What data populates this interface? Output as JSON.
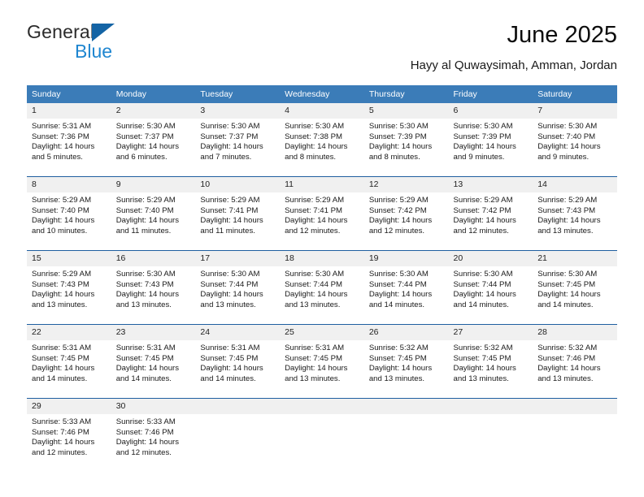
{
  "brand": {
    "line1": "General",
    "line2": "Blue",
    "triangle_color": "#1464a5",
    "blue_text_color": "#1f86d0"
  },
  "header": {
    "title": "June 2025",
    "subtitle": "Hayy al Quwaysimah, Amman, Jordan",
    "header_bg_color": "#3b7cb8",
    "row_divider_color": "#1f5fa0",
    "daynum_bg_color": "#f0f0f0"
  },
  "weekdays": [
    "Sunday",
    "Monday",
    "Tuesday",
    "Wednesday",
    "Thursday",
    "Friday",
    "Saturday"
  ],
  "weeks": [
    [
      {
        "day": "1",
        "sunrise": "Sunrise: 5:31 AM",
        "sunset": "Sunset: 7:36 PM",
        "daylight1": "Daylight: 14 hours",
        "daylight2": "and 5 minutes."
      },
      {
        "day": "2",
        "sunrise": "Sunrise: 5:30 AM",
        "sunset": "Sunset: 7:37 PM",
        "daylight1": "Daylight: 14 hours",
        "daylight2": "and 6 minutes."
      },
      {
        "day": "3",
        "sunrise": "Sunrise: 5:30 AM",
        "sunset": "Sunset: 7:37 PM",
        "daylight1": "Daylight: 14 hours",
        "daylight2": "and 7 minutes."
      },
      {
        "day": "4",
        "sunrise": "Sunrise: 5:30 AM",
        "sunset": "Sunset: 7:38 PM",
        "daylight1": "Daylight: 14 hours",
        "daylight2": "and 8 minutes."
      },
      {
        "day": "5",
        "sunrise": "Sunrise: 5:30 AM",
        "sunset": "Sunset: 7:39 PM",
        "daylight1": "Daylight: 14 hours",
        "daylight2": "and 8 minutes."
      },
      {
        "day": "6",
        "sunrise": "Sunrise: 5:30 AM",
        "sunset": "Sunset: 7:39 PM",
        "daylight1": "Daylight: 14 hours",
        "daylight2": "and 9 minutes."
      },
      {
        "day": "7",
        "sunrise": "Sunrise: 5:30 AM",
        "sunset": "Sunset: 7:40 PM",
        "daylight1": "Daylight: 14 hours",
        "daylight2": "and 9 minutes."
      }
    ],
    [
      {
        "day": "8",
        "sunrise": "Sunrise: 5:29 AM",
        "sunset": "Sunset: 7:40 PM",
        "daylight1": "Daylight: 14 hours",
        "daylight2": "and 10 minutes."
      },
      {
        "day": "9",
        "sunrise": "Sunrise: 5:29 AM",
        "sunset": "Sunset: 7:40 PM",
        "daylight1": "Daylight: 14 hours",
        "daylight2": "and 11 minutes."
      },
      {
        "day": "10",
        "sunrise": "Sunrise: 5:29 AM",
        "sunset": "Sunset: 7:41 PM",
        "daylight1": "Daylight: 14 hours",
        "daylight2": "and 11 minutes."
      },
      {
        "day": "11",
        "sunrise": "Sunrise: 5:29 AM",
        "sunset": "Sunset: 7:41 PM",
        "daylight1": "Daylight: 14 hours",
        "daylight2": "and 12 minutes."
      },
      {
        "day": "12",
        "sunrise": "Sunrise: 5:29 AM",
        "sunset": "Sunset: 7:42 PM",
        "daylight1": "Daylight: 14 hours",
        "daylight2": "and 12 minutes."
      },
      {
        "day": "13",
        "sunrise": "Sunrise: 5:29 AM",
        "sunset": "Sunset: 7:42 PM",
        "daylight1": "Daylight: 14 hours",
        "daylight2": "and 12 minutes."
      },
      {
        "day": "14",
        "sunrise": "Sunrise: 5:29 AM",
        "sunset": "Sunset: 7:43 PM",
        "daylight1": "Daylight: 14 hours",
        "daylight2": "and 13 minutes."
      }
    ],
    [
      {
        "day": "15",
        "sunrise": "Sunrise: 5:29 AM",
        "sunset": "Sunset: 7:43 PM",
        "daylight1": "Daylight: 14 hours",
        "daylight2": "and 13 minutes."
      },
      {
        "day": "16",
        "sunrise": "Sunrise: 5:30 AM",
        "sunset": "Sunset: 7:43 PM",
        "daylight1": "Daylight: 14 hours",
        "daylight2": "and 13 minutes."
      },
      {
        "day": "17",
        "sunrise": "Sunrise: 5:30 AM",
        "sunset": "Sunset: 7:44 PM",
        "daylight1": "Daylight: 14 hours",
        "daylight2": "and 13 minutes."
      },
      {
        "day": "18",
        "sunrise": "Sunrise: 5:30 AM",
        "sunset": "Sunset: 7:44 PM",
        "daylight1": "Daylight: 14 hours",
        "daylight2": "and 13 minutes."
      },
      {
        "day": "19",
        "sunrise": "Sunrise: 5:30 AM",
        "sunset": "Sunset: 7:44 PM",
        "daylight1": "Daylight: 14 hours",
        "daylight2": "and 14 minutes."
      },
      {
        "day": "20",
        "sunrise": "Sunrise: 5:30 AM",
        "sunset": "Sunset: 7:44 PM",
        "daylight1": "Daylight: 14 hours",
        "daylight2": "and 14 minutes."
      },
      {
        "day": "21",
        "sunrise": "Sunrise: 5:30 AM",
        "sunset": "Sunset: 7:45 PM",
        "daylight1": "Daylight: 14 hours",
        "daylight2": "and 14 minutes."
      }
    ],
    [
      {
        "day": "22",
        "sunrise": "Sunrise: 5:31 AM",
        "sunset": "Sunset: 7:45 PM",
        "daylight1": "Daylight: 14 hours",
        "daylight2": "and 14 minutes."
      },
      {
        "day": "23",
        "sunrise": "Sunrise: 5:31 AM",
        "sunset": "Sunset: 7:45 PM",
        "daylight1": "Daylight: 14 hours",
        "daylight2": "and 14 minutes."
      },
      {
        "day": "24",
        "sunrise": "Sunrise: 5:31 AM",
        "sunset": "Sunset: 7:45 PM",
        "daylight1": "Daylight: 14 hours",
        "daylight2": "and 14 minutes."
      },
      {
        "day": "25",
        "sunrise": "Sunrise: 5:31 AM",
        "sunset": "Sunset: 7:45 PM",
        "daylight1": "Daylight: 14 hours",
        "daylight2": "and 13 minutes."
      },
      {
        "day": "26",
        "sunrise": "Sunrise: 5:32 AM",
        "sunset": "Sunset: 7:45 PM",
        "daylight1": "Daylight: 14 hours",
        "daylight2": "and 13 minutes."
      },
      {
        "day": "27",
        "sunrise": "Sunrise: 5:32 AM",
        "sunset": "Sunset: 7:45 PM",
        "daylight1": "Daylight: 14 hours",
        "daylight2": "and 13 minutes."
      },
      {
        "day": "28",
        "sunrise": "Sunrise: 5:32 AM",
        "sunset": "Sunset: 7:46 PM",
        "daylight1": "Daylight: 14 hours",
        "daylight2": "and 13 minutes."
      }
    ],
    [
      {
        "day": "29",
        "sunrise": "Sunrise: 5:33 AM",
        "sunset": "Sunset: 7:46 PM",
        "daylight1": "Daylight: 14 hours",
        "daylight2": "and 12 minutes."
      },
      {
        "day": "30",
        "sunrise": "Sunrise: 5:33 AM",
        "sunset": "Sunset: 7:46 PM",
        "daylight1": "Daylight: 14 hours",
        "daylight2": "and 12 minutes."
      },
      {
        "day": "",
        "sunrise": "",
        "sunset": "",
        "daylight1": "",
        "daylight2": ""
      },
      {
        "day": "",
        "sunrise": "",
        "sunset": "",
        "daylight1": "",
        "daylight2": ""
      },
      {
        "day": "",
        "sunrise": "",
        "sunset": "",
        "daylight1": "",
        "daylight2": ""
      },
      {
        "day": "",
        "sunrise": "",
        "sunset": "",
        "daylight1": "",
        "daylight2": ""
      },
      {
        "day": "",
        "sunrise": "",
        "sunset": "",
        "daylight1": "",
        "daylight2": ""
      }
    ]
  ]
}
